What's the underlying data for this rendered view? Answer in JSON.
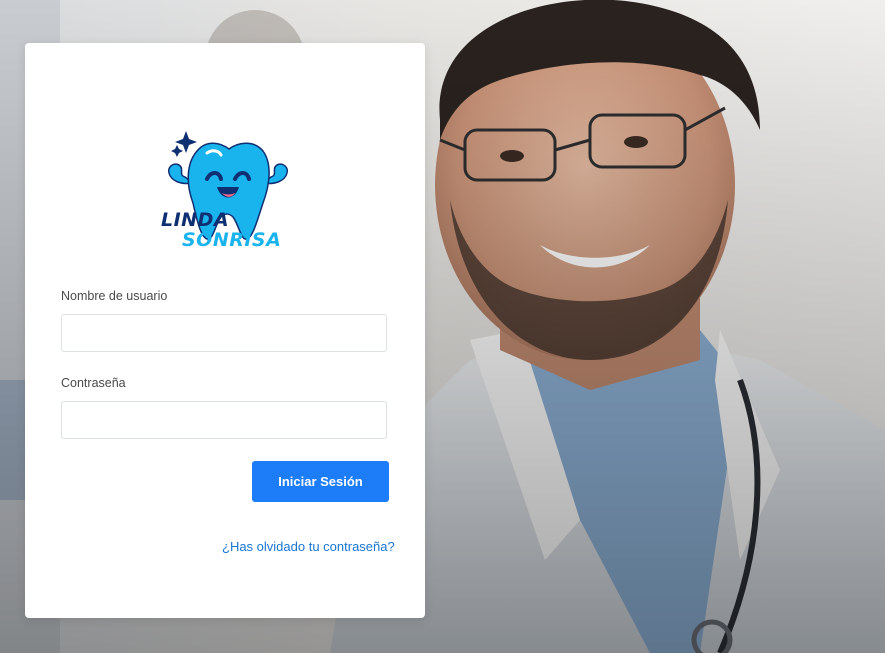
{
  "logo": {
    "line1": "LINDA",
    "line2": "SONRISA",
    "brand_dark": "#0f2f73",
    "brand_light": "#19b4ee",
    "mascot_icon": "smiling-tooth-icon"
  },
  "form": {
    "username_label": "Nombre de usuario",
    "username_value": "",
    "password_label": "Contraseña",
    "password_value": "",
    "submit_label": "Iniciar Sesión",
    "forgot_link": "¿Has olvidado tu contraseña?"
  },
  "colors": {
    "primary_button": "#1d7cf8",
    "link": "#1976d2",
    "card": "#ffffff"
  },
  "background": {
    "subject": "smiling-doctor-photo"
  }
}
